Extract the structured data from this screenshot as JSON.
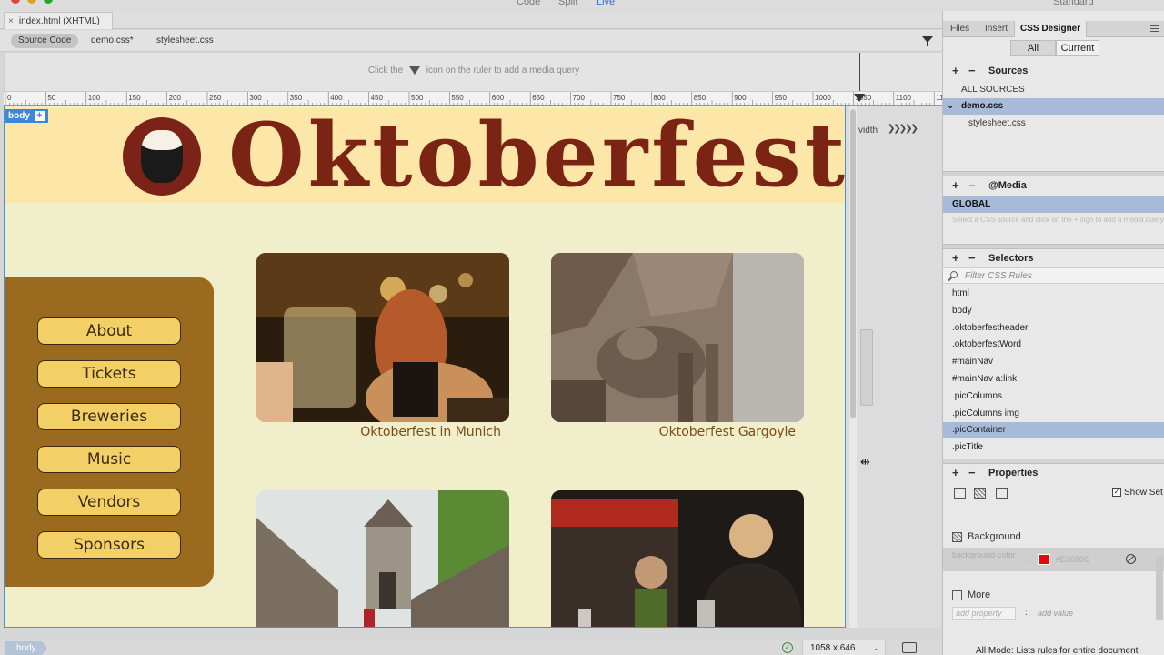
{
  "window": {
    "view_modes": [
      "Code",
      "Split",
      "Live"
    ],
    "workspace": "Standard"
  },
  "document_tab": {
    "close": "×",
    "title": "index.html (XHTML)"
  },
  "related_files": {
    "items": [
      "Source Code",
      "demo.css*",
      "stylesheet.css"
    ]
  },
  "media_query_bar": {
    "text_before": "Click the",
    "text_after": "icon on the ruler to add a media query"
  },
  "ruler": {
    "labels": [
      "0",
      "50",
      "100",
      "150",
      "200",
      "250",
      "300",
      "350",
      "400",
      "450",
      "500",
      "550",
      "600",
      "650",
      "700",
      "750",
      "800",
      "850",
      "900",
      "950",
      "1000",
      "1050",
      "1100",
      "11"
    ]
  },
  "canvas": {
    "body_tag": "body",
    "body_tag_plus": "+",
    "width_label": "vidth",
    "width_chevrons": "❯❯❯❯❯"
  },
  "site": {
    "title": "Oktoberfest",
    "nav": [
      "About",
      "Tickets",
      "Breweries",
      "Music",
      "Vendors",
      "Sponsors"
    ],
    "pictures": [
      {
        "caption": "Oktoberfest in Munich"
      },
      {
        "caption": "Oktoberfest Gargoyle"
      },
      {
        "caption": ""
      },
      {
        "caption": ""
      }
    ]
  },
  "status_bar": {
    "tag": "body",
    "size": "1058 x 646",
    "size_chevron": "⌄",
    "check": "✓"
  },
  "panel": {
    "tabs": [
      "Files",
      "Insert",
      "CSS Designer"
    ],
    "segments": [
      "All",
      "Current"
    ],
    "plus": "+",
    "minus": "−",
    "sources": {
      "title": "Sources",
      "items": [
        "ALL SOURCES",
        "demo.css",
        "stylesheet.css"
      ],
      "expand": "⌄"
    },
    "media": {
      "title": "@Media",
      "global": "GLOBAL",
      "hint": "Select a CSS source and click on the + sign to add a media query."
    },
    "selectors": {
      "title": "Selectors",
      "filter_placeholder": "Filter CSS Rules",
      "items": [
        "html",
        "body",
        ".oktoberfestheader",
        ".oktoberfestWord",
        "#mainNav",
        "#mainNav a:link",
        ".picColumns",
        ".picColumns img",
        ".picContainer",
        ".picTitle"
      ],
      "selected_index": 8
    },
    "properties": {
      "title": "Properties",
      "show_set": "Show Set",
      "show_set_check": "✓",
      "background_title": "Background",
      "bg_prop_name": "background-color",
      "colon": ":",
      "bg_prop_value": "#E3090C",
      "bg_swatch_color": "#e3090c",
      "more_title": "More",
      "add_property": "add property",
      "add_value": "add value"
    },
    "footer": "All Mode: Lists rules for entire document"
  }
}
